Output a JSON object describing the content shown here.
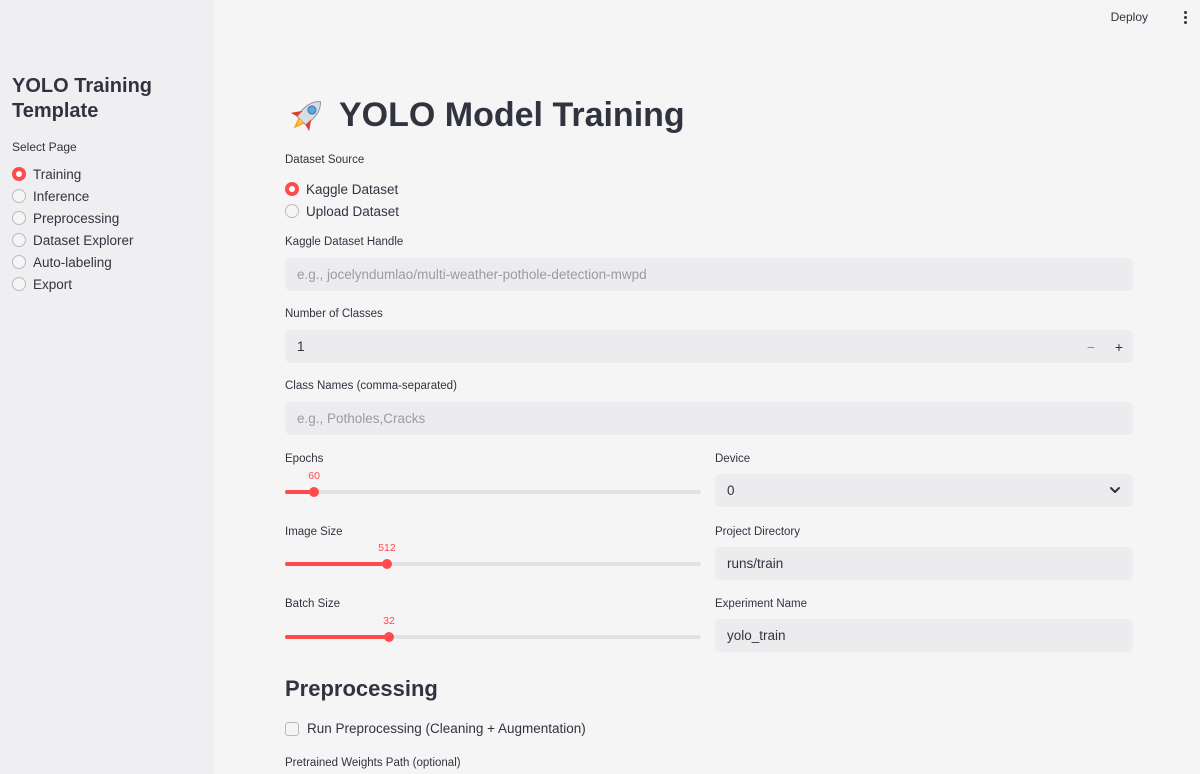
{
  "topbar": {
    "deploy_label": "Deploy",
    "menu_icon": "kebab-menu-icon"
  },
  "sidebar": {
    "title": "YOLO Training Template",
    "select_label": "Select Page",
    "items": [
      {
        "label": "Training",
        "selected": true
      },
      {
        "label": "Inference",
        "selected": false
      },
      {
        "label": "Preprocessing",
        "selected": false
      },
      {
        "label": "Dataset Explorer",
        "selected": false
      },
      {
        "label": "Auto-labeling",
        "selected": false
      },
      {
        "label": "Export",
        "selected": false
      }
    ]
  },
  "main": {
    "title_icon": "rocket-icon",
    "title": "YOLO Model Training",
    "dataset_source": {
      "label": "Dataset Source",
      "options": [
        {
          "label": "Kaggle Dataset",
          "selected": true
        },
        {
          "label": "Upload Dataset",
          "selected": false
        }
      ]
    },
    "kaggle_handle": {
      "label": "Kaggle Dataset Handle",
      "value": "",
      "placeholder": "e.g., jocelyndumlao/multi-weather-pothole-detection-mwpd"
    },
    "num_classes": {
      "label": "Number of Classes",
      "value": "1",
      "minus": "−",
      "plus": "+"
    },
    "class_names": {
      "label": "Class Names (comma-separated)",
      "value": "",
      "placeholder": "e.g., Potholes,Cracks"
    },
    "epochs": {
      "label": "Epochs",
      "value": 60,
      "value_text": "60",
      "fraction": 0.07
    },
    "image_size": {
      "label": "Image Size",
      "value": 512,
      "value_text": "512",
      "fraction": 0.245
    },
    "batch_size": {
      "label": "Batch Size",
      "value": 32,
      "value_text": "32",
      "fraction": 0.25
    },
    "device": {
      "label": "Device",
      "value": "0"
    },
    "project_dir": {
      "label": "Project Directory",
      "value": "runs/train"
    },
    "experiment_name": {
      "label": "Experiment Name",
      "value": "yolo_train"
    },
    "preprocessing": {
      "heading": "Preprocessing",
      "checkbox_label": "Run Preprocessing (Cleaning + Augmentation)",
      "checked": false
    },
    "pretrained_weights": {
      "label": "Pretrained Weights Path (optional)"
    }
  },
  "colors": {
    "accent": "#ff4b4b",
    "sidebar_bg": "#efeff1",
    "input_bg": "#ececef",
    "text": "#31333f"
  }
}
